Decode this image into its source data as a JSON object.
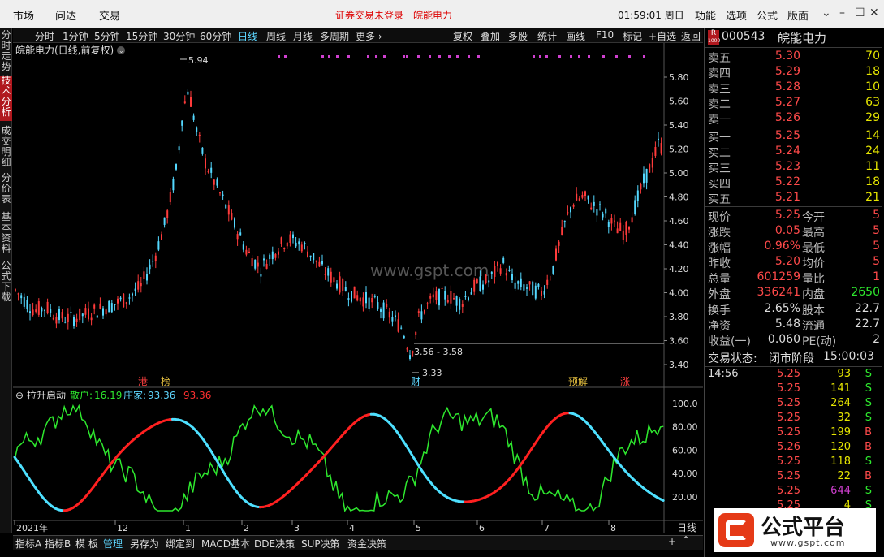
{
  "menu": {
    "items": [
      "市场",
      "问达",
      "交易"
    ],
    "notice": "证券交易未登录",
    "stock_name": "皖能电力",
    "time": "01:59:01 周日",
    "right_items": [
      "功能",
      "选项",
      "公式",
      "版面"
    ],
    "win": [
      "⌄",
      "–",
      "☐",
      "✕"
    ]
  },
  "left_tabs": [
    "分时走势",
    "技术分析",
    "成交明细",
    "分价表",
    "基本资料",
    "公式下载"
  ],
  "toolbar": {
    "periods": [
      "分时",
      "1分钟",
      "5分钟",
      "15分钟",
      "30分钟",
      "60分钟",
      "日线",
      "周线",
      "月线",
      "多周期",
      "更多 ›"
    ],
    "tools": [
      "复权",
      "叠加",
      "多股",
      "统计",
      "画线",
      "F10",
      "标记",
      "+自选",
      "返回"
    ]
  },
  "chart": {
    "title": "皖能电力(日线,前复权)",
    "watermark": "www.gspt.com",
    "high_label": "5.94",
    "low_label": "3.33",
    "range_label": "3.56 - 3.58",
    "events": [
      "港",
      "榜",
      "财",
      "预解",
      "涨"
    ],
    "price_axis": [
      "5.80",
      "5.60",
      "5.40",
      "5.20",
      "5.00",
      "4.80",
      "4.60",
      "4.40",
      "4.20",
      "4.00",
      "3.80",
      "3.60",
      "3.40"
    ],
    "indicator": {
      "name": "拉升启动",
      "sanhu_label": "散户:",
      "sanhu_val": "16.19",
      "zhuang_label": "庄家:",
      "zhuang_val": "93.36",
      "extra_val": "93.36",
      "axis": [
        "100.0",
        "80.00",
        "60.00",
        "40.00",
        "20.00"
      ]
    },
    "dates": [
      "2021年",
      "12",
      "1",
      "2",
      "3",
      "4",
      "5",
      "6",
      "7",
      "8"
    ],
    "period_label": "日线",
    "colors": {
      "up": "#ff3b3b",
      "down": "#54d8ff",
      "cyan": "#4ee0ff",
      "red": "#ff2020",
      "green": "#2ee82e"
    }
  },
  "bottom_tabs": [
    "指标A",
    "指标B",
    "模 板",
    "管理",
    "另存为",
    "绑定到",
    "MACD基本",
    "DDE决策",
    "SUP决策",
    "资金决策"
  ],
  "stock": {
    "code": "000543",
    "name": "皖能电力",
    "badge_top": "R",
    "badge_bottom": "1000",
    "asks": [
      {
        "label": "卖五",
        "price": "5.30",
        "vol": "70"
      },
      {
        "label": "卖四",
        "price": "5.29",
        "vol": "18"
      },
      {
        "label": "卖三",
        "price": "5.28",
        "vol": "10"
      },
      {
        "label": "卖二",
        "price": "5.27",
        "vol": "63"
      },
      {
        "label": "卖一",
        "price": "5.26",
        "vol": "29"
      }
    ],
    "bids": [
      {
        "label": "买一",
        "price": "5.25",
        "vol": "14"
      },
      {
        "label": "买二",
        "price": "5.24",
        "vol": "24"
      },
      {
        "label": "买三",
        "price": "5.23",
        "vol": "11"
      },
      {
        "label": "买四",
        "price": "5.22",
        "vol": "18"
      },
      {
        "label": "买五",
        "price": "5.21",
        "vol": "21"
      }
    ],
    "stats": [
      {
        "l1": "现价",
        "v1": "5.25",
        "l2": "今开",
        "v2": "5"
      },
      {
        "l1": "涨跌",
        "v1": "0.05",
        "l2": "最高",
        "v2": "5"
      },
      {
        "l1": "涨幅",
        "v1": "0.96%",
        "l2": "最低",
        "v2": "5"
      },
      {
        "l1": "昨收",
        "v1": "5.20",
        "l2": "均价",
        "v2": "5"
      },
      {
        "l1": "总量",
        "v1": "601259",
        "l2": "量比",
        "v2": "1"
      },
      {
        "l1": "外盘",
        "v1": "336241",
        "l2": "内盘",
        "v2": "2650"
      }
    ],
    "fin": [
      {
        "l1": "换手",
        "v1": "2.65%",
        "l2": "股本",
        "v2": "22.7"
      },
      {
        "l1": "净资",
        "v1": "5.48",
        "l2": "流通",
        "v2": "22.7"
      },
      {
        "l1": "收益(一)",
        "v1": "0.060",
        "l2": "PE(动)",
        "v2": "2"
      }
    ],
    "status_label": "交易状态:",
    "status": "闭市阶段",
    "status_time": "15:00:03",
    "ticks": [
      {
        "t": "14:56",
        "p": "5.25",
        "v": "93",
        "s": "S"
      },
      {
        "t": "",
        "p": "5.25",
        "v": "141",
        "s": "S"
      },
      {
        "t": "",
        "p": "5.25",
        "v": "264",
        "s": "S"
      },
      {
        "t": "",
        "p": "5.25",
        "v": "32",
        "s": "S"
      },
      {
        "t": "",
        "p": "5.25",
        "v": "199",
        "s": "B"
      },
      {
        "t": "",
        "p": "5.26",
        "v": "120",
        "s": "B"
      },
      {
        "t": "",
        "p": "5.25",
        "v": "118",
        "s": "S"
      },
      {
        "t": "",
        "p": "5.25",
        "v": "22",
        "s": "B"
      },
      {
        "t": "",
        "p": "5.25",
        "v": "644",
        "s": "S"
      },
      {
        "t": "",
        "p": "5.25",
        "v": "4",
        "s": "S"
      }
    ]
  },
  "logo": {
    "text": "公式平台",
    "url": "www.gspt.com"
  }
}
